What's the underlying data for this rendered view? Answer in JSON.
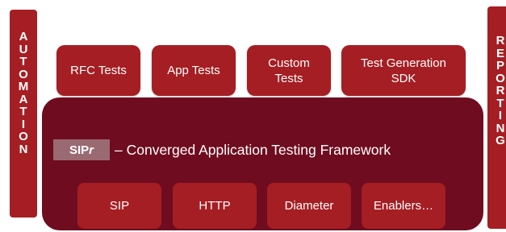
{
  "automation": {
    "letters": [
      "A",
      "U",
      "T",
      "O",
      "M",
      "A",
      "T",
      "I",
      "O",
      "N"
    ]
  },
  "reporting": {
    "letters": [
      "R",
      "E",
      "P",
      "O",
      "R",
      "T",
      "I",
      "N",
      "G"
    ]
  },
  "top_boxes": [
    {
      "label": "RFC Tests"
    },
    {
      "label": "App Tests"
    },
    {
      "label": "Custom\nTests"
    },
    {
      "label": "Test Generation\nSDK"
    }
  ],
  "framework": {
    "badge_prefix": "SIP",
    "badge_suffix": "r",
    "title": "– Converged Application Testing Framework"
  },
  "protocols": [
    {
      "label": "SIP"
    },
    {
      "label": "HTTP"
    },
    {
      "label": "Diameter"
    },
    {
      "label": "Enablers…"
    }
  ],
  "colors": {
    "box_red": "#a51e23",
    "framework_dark": "#6f0c1f",
    "badge_gray": "#9a6a72"
  }
}
